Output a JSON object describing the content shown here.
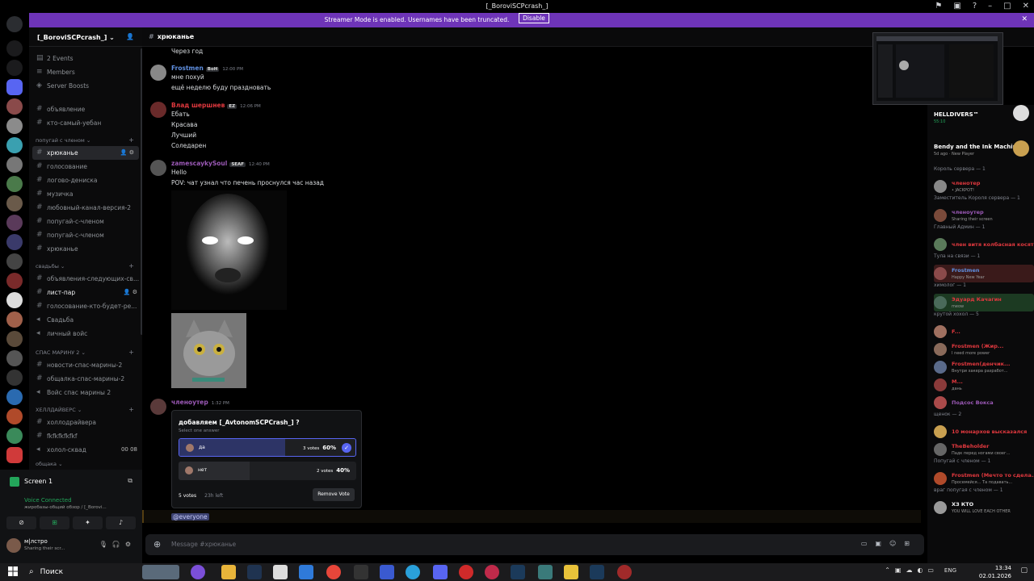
{
  "window": {
    "title": "[_BoroviSCPcrash_]"
  },
  "banner": {
    "message": "Streamer Mode is enabled. Usernames have been truncated.",
    "button": "Disable"
  },
  "server": {
    "name": "[_BoroviSCPcrash_]",
    "top_items": [
      {
        "label": "2 Events"
      },
      {
        "label": "Members"
      },
      {
        "label": "Server Boosts"
      }
    ]
  },
  "channels": {
    "ungrouped": [
      "объявление",
      "кто-самый-уебан"
    ],
    "cat1": {
      "name": "попугай с членом",
      "items": [
        "хрюканье",
        "голосование",
        "логово-дениска",
        "музичка",
        "любовный-канал-версия-2",
        "попугай-с-членом",
        "попугай-с-членом",
        "хрюканье"
      ]
    },
    "cat2": {
      "name": "свадьбы",
      "items": [
        "объявления-следующих-св...",
        "лист-пар",
        "голосование-кто-будет-ре...",
        "Свадьба",
        "личный войс"
      ]
    },
    "cat3": {
      "name": "СПАС МАРИНУ 2",
      "items": [
        "новости-спас-марины-2",
        "общалка-спас-марины-2",
        "Войс спас марины 2"
      ]
    },
    "cat4": {
      "name": "ХЕЛЛДАЙВЕРС",
      "items": [
        "холлодрайвера",
        "fkfkfkfkfkf",
        "холол-сквад"
      ],
      "badges": "00  08"
    },
    "cat5": {
      "name": "общака"
    }
  },
  "voice": {
    "screen_label": "Screen 1",
    "status": "Voice Connected",
    "sub": "жиробазы-общий обзор / [_Borovi...",
    "user_name": "м|лстро",
    "user_status": "Sharing their scr..."
  },
  "chat": {
    "channel": "хрюканье",
    "messages": [
      {
        "lines": [
          "Через год"
        ]
      },
      {
        "author": "Frostmen",
        "tag": "BoH",
        "time": "12:00 PM",
        "lines": [
          "мне похуй",
          "ещё неделю буду праздновать"
        ]
      },
      {
        "author": "Влад шершнев",
        "tag": "EZ",
        "time": "12:06 PM",
        "lines": [
          "Ебать",
          "Красава",
          "Лучший",
          "Соледарен"
        ]
      },
      {
        "author": "zamescaykySoul",
        "tag": "SEAF",
        "time": "12:40 PM",
        "lines": [
          "Hello",
          "POV: чат узнал что печень проснулся час назад"
        ]
      },
      {
        "author": "членоутер",
        "time": "1:32 PM"
      }
    ],
    "poll": {
      "question": "добавляем [_AvtonomSCPCrash_] ?",
      "hint": "Select one answer",
      "options": [
        {
          "label": "да",
          "votes": "3 votes",
          "percent": "60%",
          "fraction": 0.6,
          "chosen": true
        },
        {
          "label": "нет",
          "votes": "2 votes",
          "percent": "40%",
          "fraction": 0.4,
          "chosen": false
        }
      ],
      "total": "5 votes",
      "time_left": "23h left",
      "remove": "Remove Vote"
    },
    "mention": "@everyone",
    "composer_placeholder": "Message #хрюканье"
  },
  "activities": [
    {
      "title": "HELLDIVERS™",
      "sub": "55:10"
    },
    {
      "title": "Bendy and the Ink Machine",
      "sub": "5d ago · New Player"
    }
  ],
  "members": [
    {
      "group": "Король сервера — 1",
      "name": "членотер",
      "status": "• JACKPOT!",
      "color": "#e0383e"
    },
    {
      "group": "Заместитель Короля сервера — 1",
      "name": "членоутер",
      "status": "Sharing their screen",
      "color": "#9b59b6"
    },
    {
      "group": "Главный Админ — 1",
      "name": "член витя колбасная косят...",
      "status": "",
      "color": "#e0383e"
    },
    {
      "group": "Тула на связи — 1",
      "name": "Frostmen",
      "status": "Happy New Year",
      "color": "#5f8fe0",
      "highlight": "red"
    },
    {
      "group": "химолог — 1",
      "name": "Эдуард Качагин",
      "status": "meow",
      "color": "#e0383e",
      "highlight": "green"
    },
    {
      "group": "крутой хохол — 5",
      "name": "F...",
      "status": "",
      "color": "#e0383e"
    },
    {
      "name": "Frostmen (Жир...",
      "status": "I need more power",
      "color": "#e0383e"
    },
    {
      "name": "Frostmen(денчик...",
      "status": "Внутри хакера разработ...",
      "color": "#e0383e"
    },
    {
      "name": "M...",
      "status": "дань",
      "color": "#e0383e"
    },
    {
      "name": "Подсос Вокса",
      "status": "",
      "color": "#9b59b6"
    },
    {
      "group": "щенок — 2",
      "name": "10 монархов высказался",
      "status": "",
      "color": "#e0383e"
    },
    {
      "name": "TheBeholder",
      "status": "Падк перед ногами своег...",
      "color": "#e0383e"
    },
    {
      "group": "Попугай с членом — 1",
      "name": "Frostmen (Мечто то сдела...",
      "status": "Просемейся... Та подавать...",
      "color": "#e0383e"
    },
    {
      "group": "враг попугая с членом — 1",
      "name": "ХЗ КТО",
      "status": "YOU WILL LOVE EACH OTHER",
      "color": "#f2f3f5"
    }
  ],
  "taskbar": {
    "search": "Поиск",
    "lang": "ENG",
    "time": "13:34",
    "date": "02.01.2026"
  },
  "colors": {
    "banner": "#6e34b8",
    "accent": "#5865f2",
    "online": "#23a55a"
  }
}
